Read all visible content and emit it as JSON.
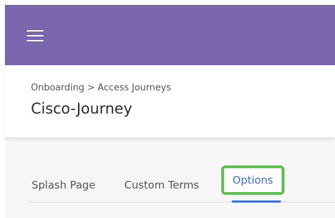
{
  "app": {
    "menu_icon": "hamburger-menu-icon",
    "brand_color": "#7966ad"
  },
  "header": {
    "breadcrumb": [
      "Onboarding",
      "Access Journeys"
    ],
    "breadcrumb_separator": ">",
    "title": "Cisco-Journey"
  },
  "tabs": {
    "items": [
      {
        "label": "Splash Page",
        "active": false
      },
      {
        "label": "Custom Terms",
        "active": false
      },
      {
        "label": "Options",
        "active": true
      }
    ],
    "active_color": "#3d6fd6",
    "highlight_color": "#5ec04e"
  }
}
